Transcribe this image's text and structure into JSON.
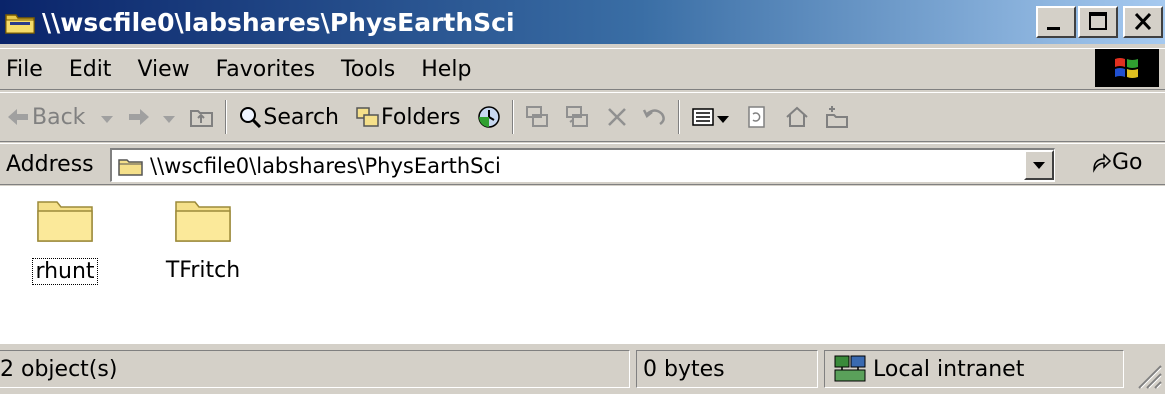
{
  "window": {
    "title": "\\\\wscfile0\\labshares\\PhysEarthSci"
  },
  "menu": {
    "items": [
      "File",
      "Edit",
      "View",
      "Favorites",
      "Tools",
      "Help"
    ]
  },
  "toolbar": {
    "back_label": "Back",
    "search_label": "Search",
    "folders_label": "Folders"
  },
  "address": {
    "label": "Address",
    "value": "\\\\wscfile0\\labshares\\PhysEarthSci",
    "go_label": "Go"
  },
  "files": [
    {
      "name": "rhunt",
      "selected": true
    },
    {
      "name": "TFritch",
      "selected": false
    }
  ],
  "status": {
    "objects": "2 object(s)",
    "size": "0 bytes",
    "zone": "Local intranet"
  },
  "colors": {
    "title_gradient_start": "#0a246a",
    "title_gradient_end": "#a6caf0",
    "face": "#d4d0c8",
    "folder_yellow": "#f5e08a"
  }
}
